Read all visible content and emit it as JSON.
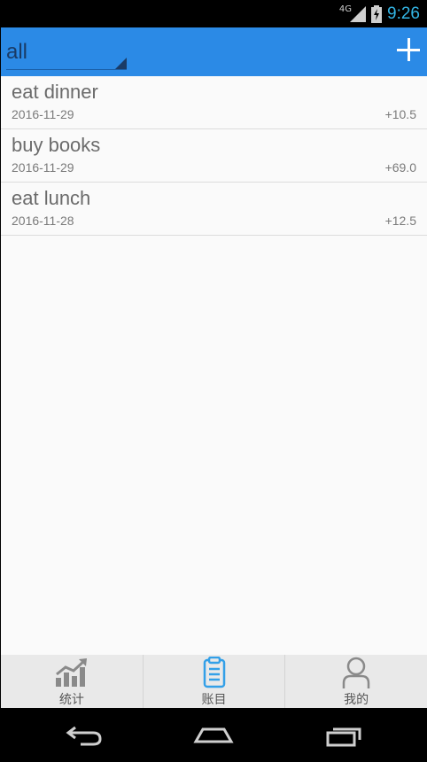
{
  "status_bar": {
    "network": "4G",
    "time": "9:26"
  },
  "app_bar": {
    "filter_value": "all"
  },
  "entries": [
    {
      "title": "eat dinner",
      "date": "2016-11-29",
      "amount": "+10.5"
    },
    {
      "title": "buy books",
      "date": "2016-11-29",
      "amount": "+69.0"
    },
    {
      "title": "eat lunch",
      "date": "2016-11-28",
      "amount": "+12.5"
    }
  ],
  "tabs": [
    {
      "label": "统计",
      "icon": "chart-icon"
    },
    {
      "label": "账目",
      "icon": "clipboard-icon"
    },
    {
      "label": "我的",
      "icon": "person-icon"
    }
  ],
  "colors": {
    "app_bar": "#2b8ae6",
    "active_tab": "#33a0e8",
    "status_time": "#33b5e5"
  }
}
